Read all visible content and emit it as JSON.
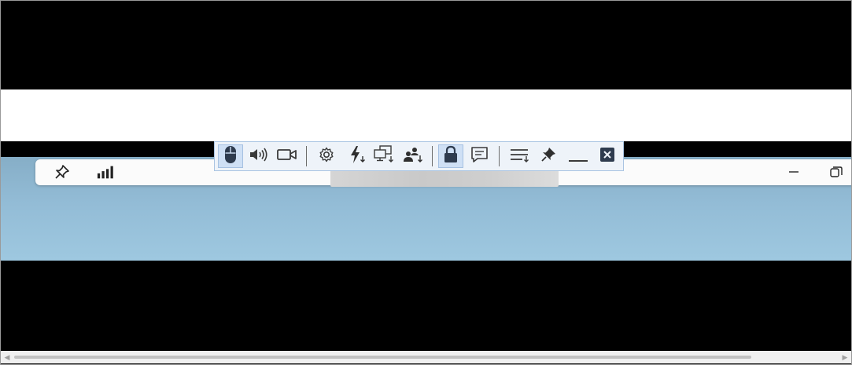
{
  "remote_bar": {
    "left_icons": [
      "pin-icon",
      "signal-strength-icon"
    ],
    "connection_label": "",
    "window_controls": [
      "minimize-icon",
      "restore-icon"
    ]
  },
  "toolbar": {
    "items": [
      {
        "name": "mouse-icon",
        "active": true
      },
      {
        "name": "speaker-icon",
        "active": false
      },
      {
        "name": "camera-icon",
        "active": false
      },
      {
        "name": "settings-gear-icon",
        "active": false
      },
      {
        "name": "actions-lightning-icon",
        "active": false
      },
      {
        "name": "switch-monitor-icon",
        "active": false
      },
      {
        "name": "switch-user-icon",
        "active": false
      },
      {
        "name": "lock-icon",
        "active": true
      },
      {
        "name": "chat-icon",
        "active": false
      },
      {
        "name": "menu-list-icon",
        "active": false
      },
      {
        "name": "pin-toolbar-icon",
        "active": false
      },
      {
        "name": "minimize-toolbar-icon",
        "active": false
      },
      {
        "name": "close-session-icon",
        "active": false
      }
    ],
    "colors": {
      "background": "#eef3f9",
      "border": "#a9c4e2",
      "active": "#cfe0f5",
      "icon": "#3a3a3a"
    }
  },
  "scrollbar": {
    "left_arrow": "◀",
    "right_arrow": "▶"
  }
}
